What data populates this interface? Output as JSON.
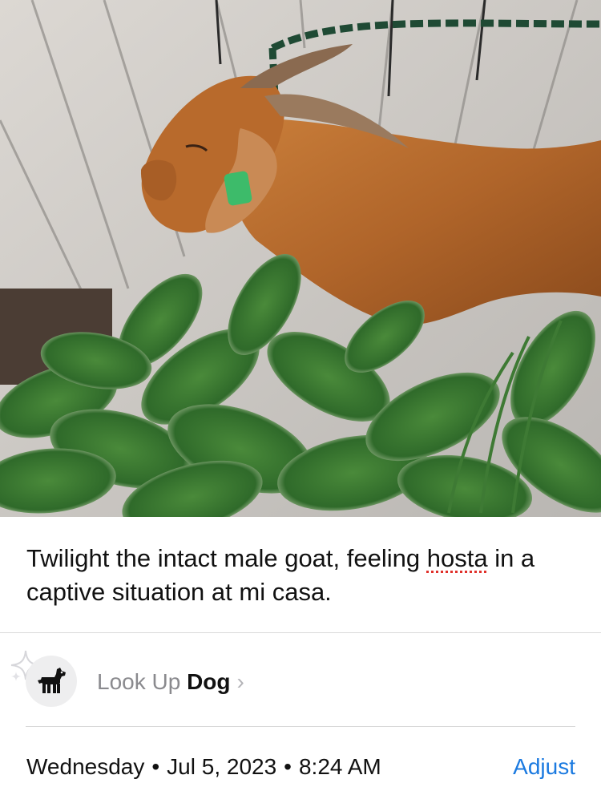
{
  "photo": {
    "subject": "goat-in-hosta"
  },
  "caption": {
    "text_before": "Twilight the intact male goat, feeling ",
    "misspelled_word": "hosta",
    "text_after": " in a captive situation at mi casa."
  },
  "lookup": {
    "prefix": "Look Up",
    "subject": "Dog",
    "chevron": "›",
    "icon": "dog-icon"
  },
  "meta": {
    "weekday": "Wednesday",
    "separator": "•",
    "date": "Jul 5, 2023",
    "time": "8:24 AM",
    "adjust_label": "Adjust"
  },
  "colors": {
    "accent": "#1b7ae0",
    "spellcheck": "#e0302a"
  }
}
